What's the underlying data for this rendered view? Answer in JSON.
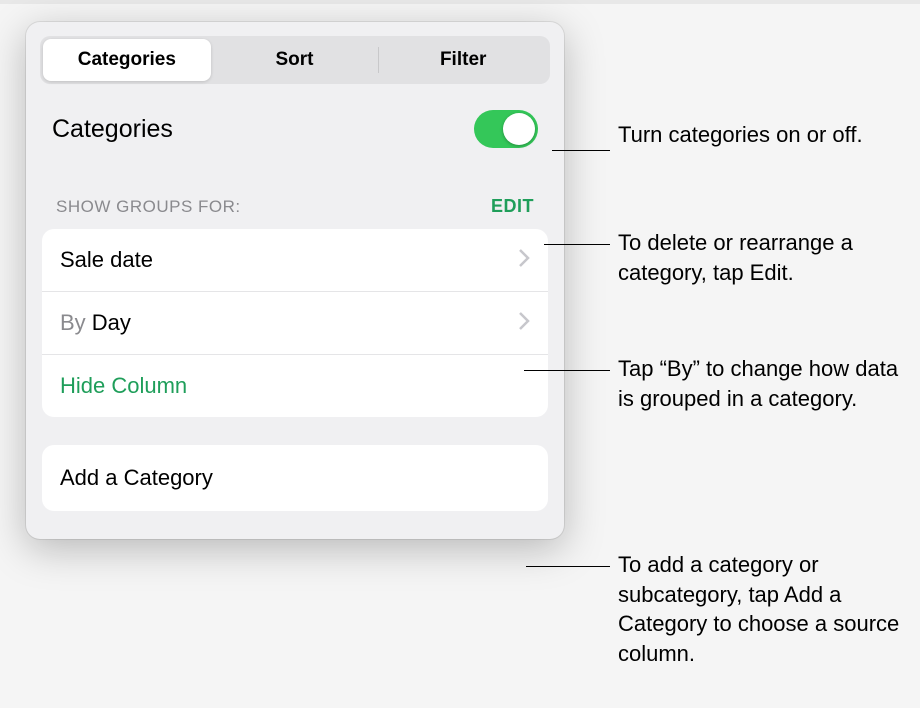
{
  "tabs": {
    "categories": "Categories",
    "sort": "Sort",
    "filter": "Filter"
  },
  "header": {
    "title": "Categories"
  },
  "groups": {
    "label": "SHOW GROUPS FOR:",
    "edit": "EDIT",
    "category": "Sale date",
    "by_prefix": "By ",
    "by_value": "Day",
    "hide": "Hide Column"
  },
  "add": {
    "label": "Add a Category"
  },
  "callouts": {
    "toggle": "Turn categories on or off.",
    "edit": "To delete or rearrange a category, tap Edit.",
    "by": "Tap “By” to change how data is grouped in a category.",
    "add": "To add a category or subcategory, tap Add a Category to choose a source column."
  }
}
